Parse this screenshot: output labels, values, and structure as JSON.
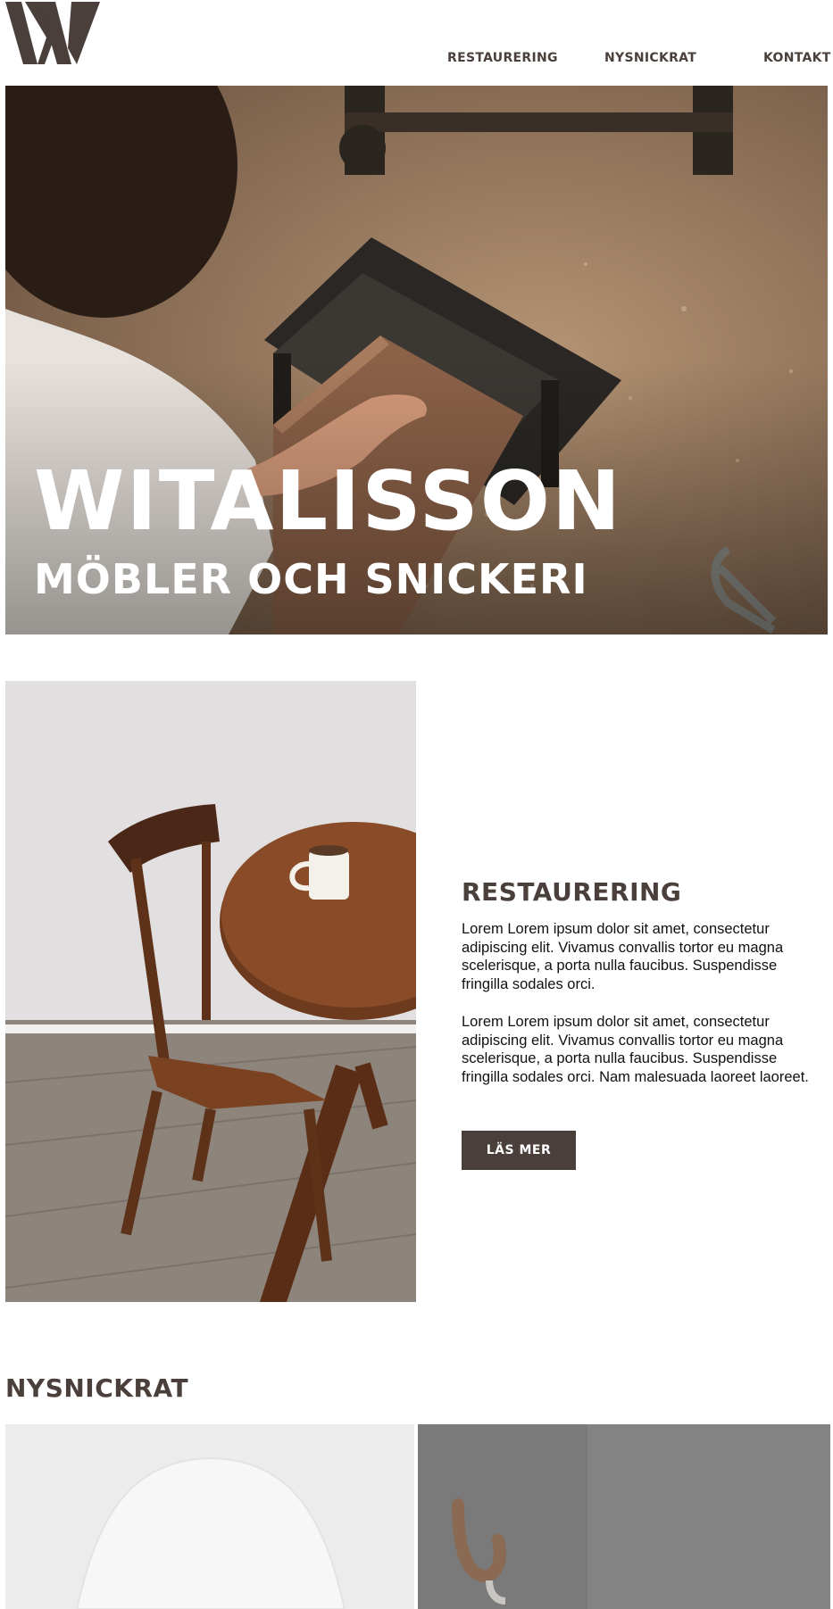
{
  "header": {
    "logo_icon": "witalisson-w-logo-icon",
    "nav": [
      "RESTAURERING",
      "NYSNICKRAT",
      "KONTAKT"
    ]
  },
  "hero": {
    "title": "WITALISSON",
    "subtitle": "MÖBLER OCH SNICKERI",
    "image": "woodworker-sanding-board-photo"
  },
  "restaurering": {
    "title": "RESTAURERING",
    "paragraph1": "Lorem Lorem ipsum dolor sit amet, consectetur adipiscing elit. Vivamus convallis tortor eu magna scelerisque, a porta nulla faucibus. Suspendisse fringilla sodales orci.",
    "paragraph2": "Lorem Lorem ipsum dolor sit amet, consectetur adipiscing elit.  Vivamus convallis tortor eu magna scelerisque, a porta nulla faucibus. Suspendisse fringilla sodales orci. Nam malesuada laoreet  laoreet.",
    "button_label": "LÄS MER",
    "image": "wooden-chair-and-table-photo"
  },
  "nysnickrat": {
    "title": "NYSNICKRAT",
    "images": [
      "white-chair-photo",
      "wooden-hooks-photo"
    ]
  },
  "colors": {
    "brand": "#4a3f3a",
    "button_bg": "#4a3f3a",
    "text": "#111111"
  }
}
